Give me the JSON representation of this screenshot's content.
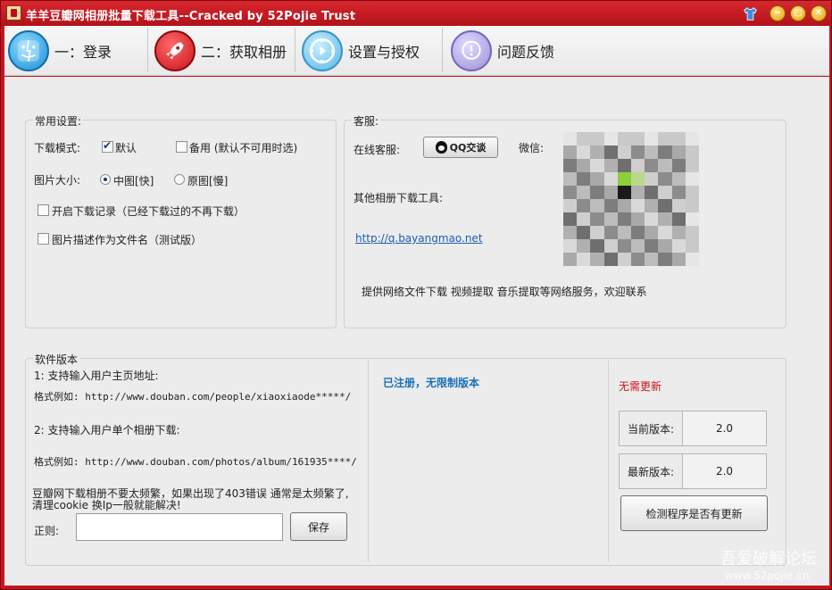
{
  "window": {
    "title": "羊羊豆瓣网相册批量下载工具--Cracked by 52Pojie Trust",
    "controls": {
      "minimize": "−",
      "maximize": "□",
      "close": "✕"
    }
  },
  "tabs": [
    {
      "label": "一：登录",
      "icon": "login-finder-icon"
    },
    {
      "label": "二：获取相册",
      "icon": "rocket-icon"
    },
    {
      "label": "设置与授权",
      "icon": "media-control-icon"
    },
    {
      "label": "问题反馈",
      "icon": "exclamation-icon"
    }
  ],
  "common_settings": {
    "title": "常用设置:",
    "download_mode_label": "下载模式:",
    "default_option": "默认",
    "backup_option": "备用 (默认不可用时选)",
    "image_size_label": "图片大小:",
    "medium_option": "中图[快]",
    "original_option": "原图[慢]",
    "download_record": "开启下载记录（已经下载过的不再下载）",
    "desc_as_filename": "图片描述作为文件名（测试版）"
  },
  "service": {
    "title": "客服:",
    "online_label": "在线客服:",
    "qq_button": "QQ交谈",
    "wechat_label": "微信:",
    "other_tools_label": "其他相册下载工具:",
    "link": "http://q.bayangmao.net",
    "services_text": "提供网络文件下载 视频提取  音乐提取等网络服务，欢迎联系"
  },
  "version": {
    "title": "软件版本",
    "line1": "1: 支持输入用户主页地址:",
    "example1": "格式例如: http://www.douban.com/people/xiaoxiaode*****/",
    "line2": "2: 支持输入用户单个相册下载:",
    "example2": "格式例如: http://www.douban.com/photos/album/161935****/",
    "warning_line1": "豆瓣网下载相册不要太频繁，如果出现了403错误 通常是太频繁了,",
    "warning_line2": "清理cookie 换Ip一般就能解决!",
    "regex_label": "正则:",
    "regex_value": "",
    "save_button": "保存",
    "registered_text": "已注册，无限制版本",
    "update_status": "无需更新",
    "current_version_label": "当前版本:",
    "current_version": "2.0",
    "latest_version_label": "最新版本:",
    "latest_version": "2.0",
    "check_update_button": "检测程序是否有更新"
  },
  "watermark": {
    "line1": "吾爱破解论坛",
    "line2": "www.52pojie.cn"
  },
  "colors": {
    "title_bar": "#c4161f",
    "link": "#1a5fb4",
    "registered": "#1a6fb8",
    "update_status": "#c8121b"
  }
}
